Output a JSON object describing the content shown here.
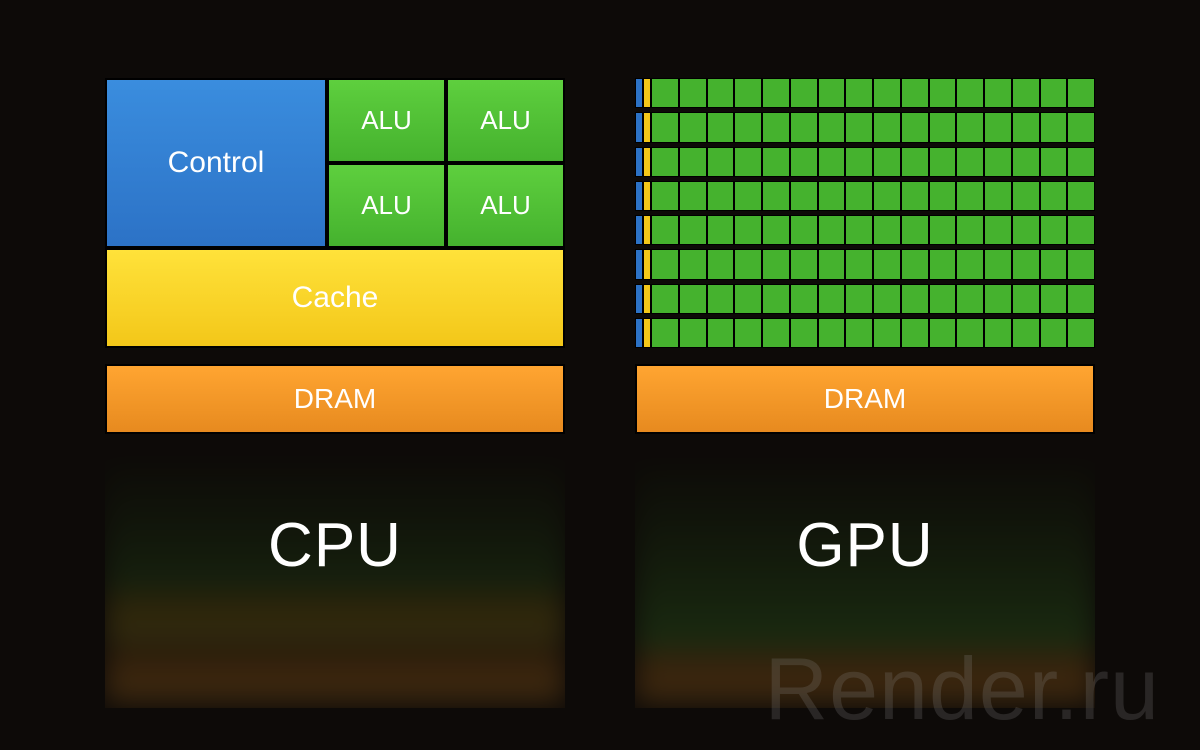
{
  "cpu": {
    "title": "CPU",
    "control": "Control",
    "alu": "ALU",
    "cache": "Cache",
    "dram": "DRAM"
  },
  "gpu": {
    "title": "GPU",
    "dram": "DRAM",
    "rows": 8,
    "cores_per_row": 16
  },
  "colors": {
    "control": "#2c72c6",
    "alu": "#45b22e",
    "cache": "#f3c719",
    "dram": "#e78a1f"
  },
  "watermark": "Render.ru"
}
